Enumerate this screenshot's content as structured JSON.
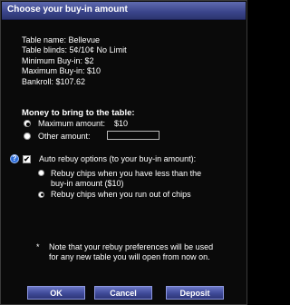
{
  "window": {
    "title": "Choose your buy-in amount"
  },
  "table_info": {
    "name": "Table name: Bellevue",
    "blinds": "Table blinds: 5¢/10¢  No Limit",
    "min_buyin": "Minimum Buy-in: $2",
    "max_buyin": "Maximum Buy-in: $10",
    "bankroll": "Bankroll: $107.62"
  },
  "money": {
    "title": "Money to bring to the table:",
    "max_label": "Maximum amount:",
    "max_value": "$10",
    "other_label": "Other amount:",
    "other_value": ""
  },
  "auto_rebuy": {
    "label": "Auto rebuy options (to your buy-in amount):",
    "checked": true,
    "option1_line1": "Rebuy chips when you have less than the",
    "option1_line2": "buy-in amount ($10)",
    "option2": "Rebuy chips when you run out of chips",
    "selected": 2
  },
  "note": {
    "star": "*",
    "line1": "Note that your rebuy preferences will be used",
    "line2": "for any new table you will open from now on."
  },
  "buttons": {
    "ok": "OK",
    "cancel": "Cancel",
    "deposit": "Deposit"
  },
  "icons": {
    "help": "?",
    "check": "✔"
  }
}
